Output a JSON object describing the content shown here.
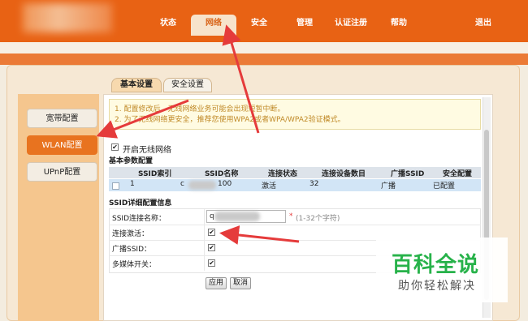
{
  "topnav": {
    "items": [
      "状态",
      "网络",
      "安全",
      "管理",
      "认证注册",
      "帮助"
    ],
    "active_index": 1,
    "logout": "退出"
  },
  "tabs": [
    "基本设置",
    "安全设置"
  ],
  "sidebar": [
    "宽带配置",
    "WLAN配置",
    "UPnP配置"
  ],
  "notice": {
    "line1": "1. 配置修改后，无线网络业务可能会出现短暂中断。",
    "line2": "2. 为了无线网络更安全，推荐您使用WPA2或者WPA/WPA2验证模式。"
  },
  "enable_wifi": {
    "label": "开启无线网络",
    "checked": "✔"
  },
  "basic_params_title": "基本参数配置",
  "ssid_table": {
    "headers": [
      "SSID索引",
      "SSID名称",
      "连接状态",
      "连接设备数目",
      "广播SSID",
      "安全配置"
    ],
    "row": {
      "index": "1",
      "name_prefix": "c",
      "name_suffix": "100",
      "status": "激活",
      "devices": "32",
      "broadcast": "广播",
      "security": "已配置"
    }
  },
  "detail_title": "SSID详细配置信息",
  "form": {
    "ssid_label": "SSID连接名称：",
    "ssid_value_prefix": "q",
    "ssid_hint": "(1-32个字符)",
    "required_star": "*",
    "active_label": "连接激活：",
    "broadcast_label": "广播SSID：",
    "multimedia_label": "多媒体开关：",
    "check": "✔"
  },
  "buttons": {
    "apply": "应用",
    "cancel": "取消"
  },
  "watermark": {
    "title": "百科全说",
    "subtitle": "助你轻松解决"
  },
  "colors": {
    "brand_orange": "#e86214",
    "active_tab": "#e8731f",
    "arrow_red": "#e53b3b",
    "watermark_green": "#27b24a"
  }
}
